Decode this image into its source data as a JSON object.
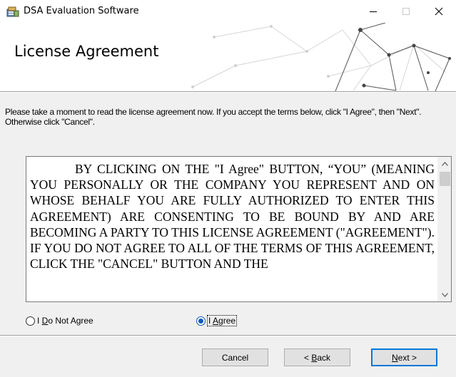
{
  "window": {
    "title": "DSA Evaluation Software",
    "controls": {
      "minimize": "minimize-icon",
      "maximize": "maximize-icon",
      "close": "close-icon"
    }
  },
  "banner": {
    "title": "License Agreement"
  },
  "instructions": "Please take a moment to read the license agreement now. If you accept the terms below, click \"I Agree\", then \"Next\". Otherwise click \"Cancel\".",
  "license": {
    "text": "BY CLICKING ON THE \"I Agree\" BUTTON, “YOU” (MEANING YOU PERSONALLY OR THE COMPANY YOU REPRESENT AND ON WHOSE BEHALF YOU ARE FULLY AUTHORIZED TO ENTER THIS AGREEMENT) ARE CONSENTING TO BE BOUND BY AND ARE BECOMING A PARTY TO THIS LICENSE AGREEMENT (\"AGREEMENT\"). IF YOU DO NOT AGREE TO ALL OF THE TERMS OF THIS AGREEMENT, CLICK THE \"CANCEL\" BUTTON AND THE"
  },
  "options": {
    "disagree": {
      "prefix": "I ",
      "accel": "D",
      "rest": "o Not Agree",
      "selected": false
    },
    "agree": {
      "prefix": "I ",
      "accel": "A",
      "rest": "gree",
      "selected": true
    }
  },
  "buttons": {
    "cancel": "Cancel",
    "back": {
      "prefix": "< ",
      "accel": "B",
      "rest": "ack"
    },
    "next": {
      "accel": "N",
      "rest": "ext >"
    }
  },
  "colors": {
    "accent": "#0078d7",
    "radio_selected": "#0a58c4"
  }
}
